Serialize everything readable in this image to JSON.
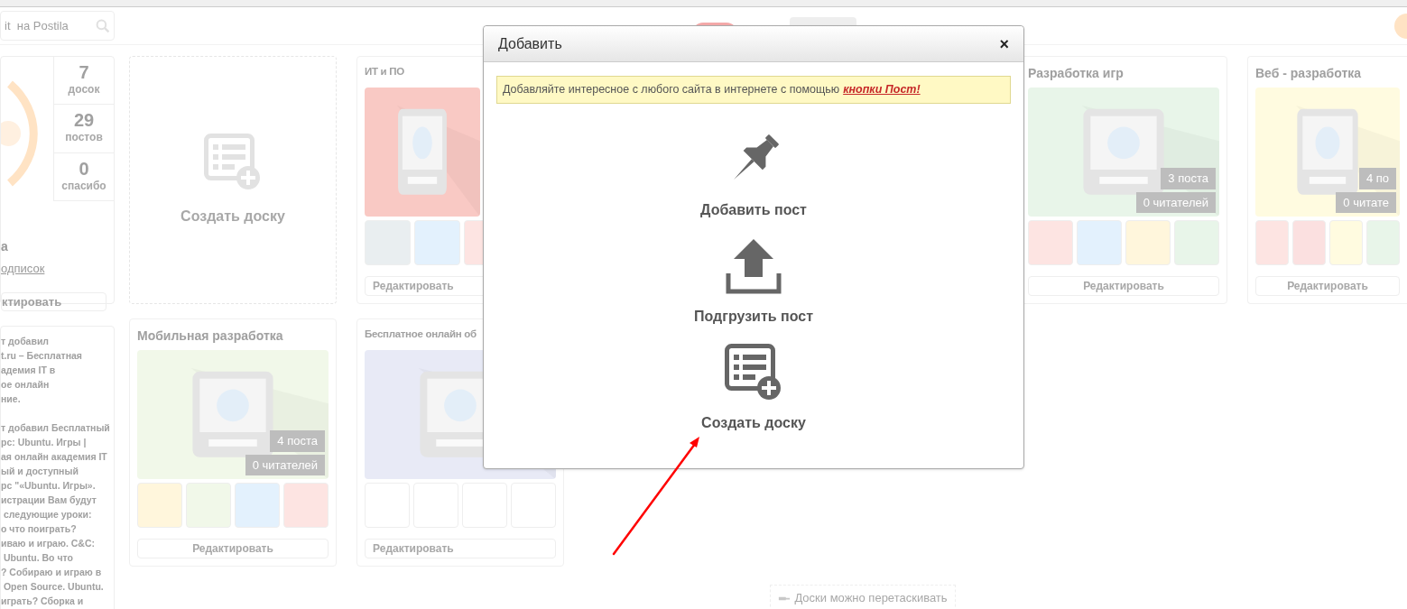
{
  "header": {
    "search": {
      "placeholder": "it  на Postila"
    }
  },
  "profile": {
    "stats": [
      {
        "value": "7",
        "label": "досок"
      },
      {
        "value": "29",
        "label": "постов"
      },
      {
        "value": "0",
        "label": "спасибо"
      }
    ],
    "name": "а",
    "link": "одписок",
    "button": "ктировать"
  },
  "feed": {
    "paragraphs": [
      [
        "т добавил",
        "t.ru – Бесплатная",
        "адемия IT в",
        "ое онлайн",
        "ние."
      ],
      [
        "т добавил Бесплатный",
        "рс: Ubuntu. Игры |",
        "ая онлайн академия IT",
        "ый и доступный",
        "рс \"«Ubuntu. Игры».",
        "истрации Вам будут",
        " следующие уроки:",
        "о что поиграть?",
        "иваю и играю. C&C:",
        " Ubuntu. Во что",
        "? Собираю и играю в",
        " Open Source. Ubuntu.",
        "играть? Сборка и"
      ]
    ]
  },
  "boards": [
    [
      {
        "kind": "create",
        "label": "Создать доску"
      },
      {
        "kind": "board",
        "title": "ИТ и ПО",
        "color": "#f9c9c4",
        "thumbnails": [
          {
            "color": "#e9eef0"
          },
          {
            "color": "#e3f1fd"
          },
          {
            "color": "#fde4e2"
          }
        ],
        "button": "Редактировать"
      },
      {
        "kind": "gap"
      },
      {
        "kind": "board",
        "title": "Разработка игр",
        "color": "#e8f5e9",
        "counts": [
          "3 поста",
          "0 читателей"
        ],
        "thumbnails": [
          {
            "color": "#fde4e2"
          },
          {
            "color": "#e3f1fd"
          },
          {
            "color": "#fff6dc"
          },
          {
            "color": "#e8f5e9"
          }
        ],
        "button": "Редактировать"
      },
      {
        "kind": "board",
        "title": "Веб - разработка",
        "color": "#fffbe0",
        "counts": [
          "4 по",
          "0 читате"
        ],
        "thumbnails": [
          {
            "color": "#fde4e2"
          },
          {
            "color": "#fbe0e0"
          },
          {
            "color": "#fffbe0"
          },
          {
            "color": "#e8f5e9"
          }
        ],
        "button": "Редактировать"
      }
    ],
    [
      {
        "kind": "board",
        "title": "Мобильная разработка",
        "color": "#f1f8e9",
        "counts": [
          "4 поста",
          "0 читателей"
        ],
        "thumbnails": [
          {
            "color": "#fff6dc"
          },
          {
            "color": "#f1f8e9"
          },
          {
            "color": "#e3f1fd"
          },
          {
            "color": "#fde4e2"
          }
        ],
        "button": "Редактировать"
      },
      {
        "kind": "board",
        "title": "Бесплатное онлайн об",
        "color": "#e8eaf6",
        "thumbnails": [
          {
            "color": "#ffffff"
          },
          {
            "color": "#ffffff"
          },
          {
            "color": "#ffffff"
          },
          {
            "color": "#ffffff"
          }
        ],
        "button": "Редактировать"
      }
    ]
  ],
  "hint": "Доски можно перетаскивать",
  "modal": {
    "title": "Добавить",
    "close": "×",
    "notice": {
      "text": "Добавляйте интересное с любого сайта в интернете с помощью",
      "link": "кнопки Пост!"
    },
    "actions": [
      {
        "kind": "pin",
        "label": "Добавить пост"
      },
      {
        "kind": "upload",
        "label": "Подгрузить пост"
      },
      {
        "kind": "board",
        "label": "Создать доску"
      }
    ]
  }
}
